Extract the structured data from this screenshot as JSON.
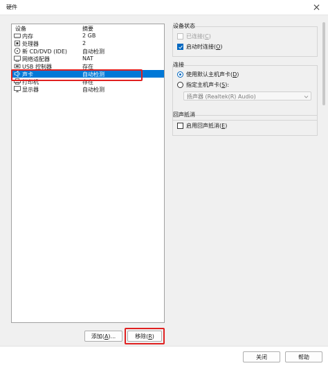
{
  "window": {
    "title": "硬件"
  },
  "device_list": {
    "columns": [
      "设备",
      "摘要"
    ],
    "rows": [
      {
        "icon": "memory-icon",
        "device": "内存",
        "summary": "2 GB",
        "selected": false
      },
      {
        "icon": "processor-icon",
        "device": "处理器",
        "summary": "2",
        "selected": false
      },
      {
        "icon": "cd-dvd-icon",
        "device": "新 CD/DVD (IDE)",
        "summary": "自动检测",
        "selected": false
      },
      {
        "icon": "network-adapter-icon",
        "device": "网络适配器",
        "summary": "NAT",
        "selected": false
      },
      {
        "icon": "usb-controller-icon",
        "device": "USB 控制器",
        "summary": "存在",
        "selected": false
      },
      {
        "icon": "sound-card-icon",
        "device": "声卡",
        "summary": "自动检测",
        "selected": true
      },
      {
        "icon": "printer-icon",
        "device": "打印机",
        "summary": "存在",
        "selected": false
      },
      {
        "icon": "display-icon",
        "device": "显示器",
        "summary": "自动检测",
        "selected": false
      }
    ]
  },
  "buttons": {
    "add_label": "添加(",
    "add_key": "A",
    "add_suffix": ")...",
    "remove_label": "移除(",
    "remove_key": "R",
    "remove_suffix": ")",
    "close_label": "关闭",
    "help_label": "帮助"
  },
  "device_status": {
    "title": "设备状态",
    "connected_label": "已连接(",
    "connected_key": "C",
    "connected_suffix": ")",
    "connect_on_power_label": "启动时连接(",
    "connect_on_power_key": "O",
    "connect_on_power_suffix": ")",
    "connected_checked": false,
    "connect_on_power_checked": true
  },
  "connection": {
    "title": "连接",
    "default_host_label": "使用默认主机声卡(",
    "default_host_key": "D",
    "default_host_suffix": ")",
    "specify_host_label": "指定主机声卡(",
    "specify_host_key": "S",
    "specify_host_suffix": "):",
    "host_sound_value": "扬声器 (Realtek(R) Audio)",
    "selected_option": "default"
  },
  "echo_cancellation": {
    "title": "回声抵消",
    "enable_label": "启用回声抵消(",
    "enable_key": "E",
    "enable_suffix": ")",
    "enabled": false
  },
  "colors": {
    "selection": "#0078d7",
    "annotation": "#e02020",
    "accent": "#0067c0"
  }
}
